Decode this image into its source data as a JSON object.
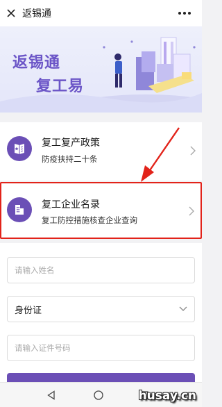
{
  "header": {
    "title": "返锡通",
    "close_icon": "close-icon",
    "more_icon": "more-dots-icon"
  },
  "banner": {
    "line1": "返锡通",
    "line2": "复工易"
  },
  "cards": [
    {
      "title": "复工复产政策",
      "subtitle": "防疫扶持二十条",
      "icon": "policy-document-icon"
    },
    {
      "title": "复工企业名录",
      "subtitle": "复工防控措施核查企业查询",
      "icon": "building-icon"
    }
  ],
  "form": {
    "name_placeholder": "请输入姓名",
    "id_type_selected": "身份证",
    "id_number_placeholder": "请输入证件号码"
  },
  "nav": {
    "back_icon": "nav-back-icon",
    "home_icon": "nav-home-icon",
    "recent_icon": "nav-recent-icon"
  },
  "watermark": "husay.cn",
  "colors": {
    "accent": "#6b4fb6",
    "highlight": "#e2231a"
  }
}
